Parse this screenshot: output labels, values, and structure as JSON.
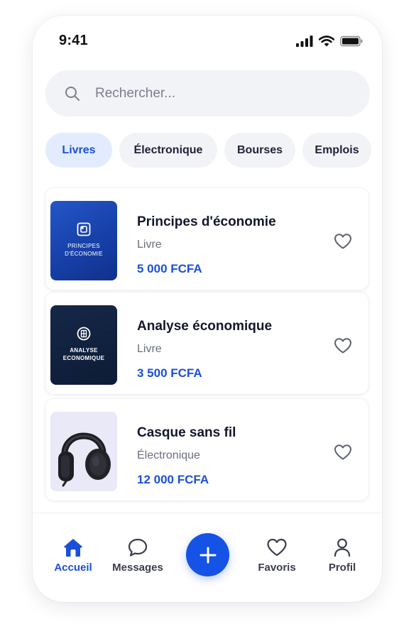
{
  "status_bar": {
    "time": "9:41"
  },
  "search": {
    "placeholder": "Rechercher..."
  },
  "categories": [
    {
      "label": "Livres",
      "active": true
    },
    {
      "label": "Électronique",
      "active": false
    },
    {
      "label": "Bourses",
      "active": false
    },
    {
      "label": "Emplois",
      "active": false
    }
  ],
  "products": [
    {
      "name": "Principes d'économie",
      "category": "Livre",
      "price": "5 000 FCFA",
      "cover_title": [
        "PRINCIPES",
        "D'ÉCONOMIE"
      ]
    },
    {
      "name": "Analyse économique",
      "category": "Livre",
      "price": "3 500 FCFA",
      "cover_title": [
        "ANALYSE",
        "ECONOMIQUE"
      ]
    },
    {
      "name": "Casque sans fil",
      "category": "Électronique",
      "price": "12 000 FCFA"
    }
  ],
  "bottom_nav": {
    "home": "Accueil",
    "messages": "Messages",
    "favorites": "Favoris",
    "profile": "Profil"
  },
  "colors": {
    "accent": "#1b4fd8",
    "fab": "#1552e6",
    "chip_active_bg": "#e3ecff"
  }
}
